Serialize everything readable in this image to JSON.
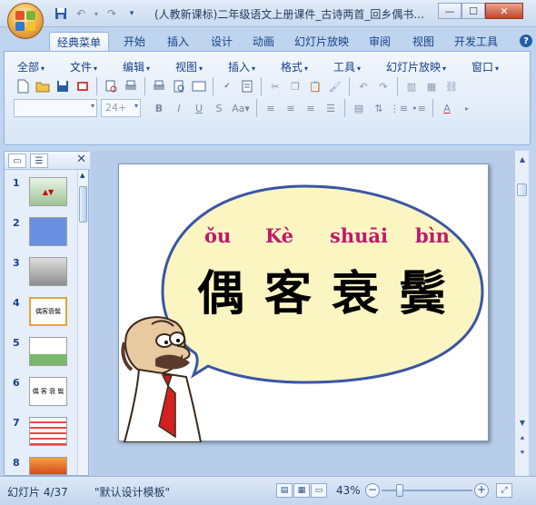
{
  "window": {
    "title": "(人教新课标)二年级语文上册课件_古诗两首_回乡偶书...",
    "minimize": "—",
    "maximize": "☐",
    "close": "✕"
  },
  "quick_access": {
    "undo": "↶",
    "redo": "↷"
  },
  "tabs": [
    "经典菜单",
    "开始",
    "插入",
    "设计",
    "动画",
    "幻灯片放映",
    "审阅",
    "视图",
    "开发工具"
  ],
  "classic_menu": [
    "全部",
    "文件",
    "编辑",
    "视图",
    "插入",
    "格式",
    "工具",
    "幻灯片放映",
    "窗口"
  ],
  "font_size": "24+",
  "slide_panel": {
    "slide_numbers": [
      "1",
      "2",
      "3",
      "4",
      "5",
      "6",
      "7",
      "8"
    ],
    "slide4_thumb_text": "偶客衰鬓",
    "slide6_thumb_text": "偶 客 衰 鬓"
  },
  "slide": {
    "pinyin": [
      "ǒu",
      "Kè",
      "shuāi",
      "bìn"
    ],
    "characters": [
      "偶",
      "客",
      "衰",
      "鬓"
    ],
    "bubble_color": "#fbf5c2",
    "bubble_border": "#3a55a5",
    "pinyin_color": "#c0186a"
  },
  "status": {
    "slide_counter": "幻灯片 4/37",
    "theme": "\"默认设计模板\"",
    "zoom": "43%",
    "zoom_fraction": 0.43
  }
}
